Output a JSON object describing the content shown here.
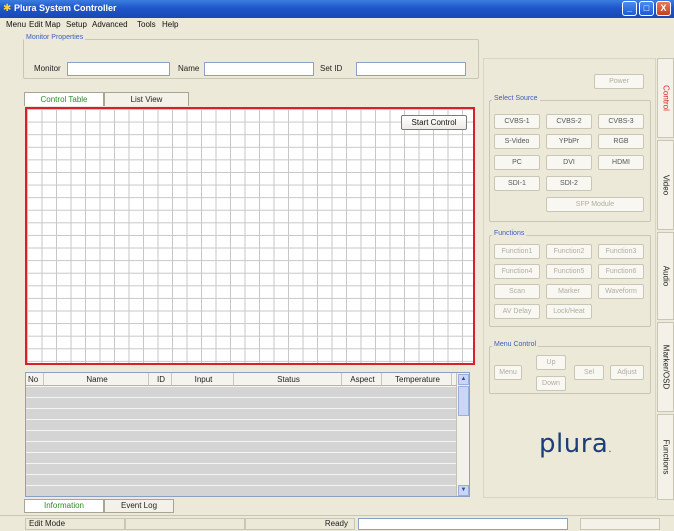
{
  "window": {
    "title": "Plura System Controller",
    "buttons": [
      "_",
      "□",
      "X"
    ]
  },
  "menu": [
    "Menu",
    "Edit Map",
    "Setup",
    "Advanced",
    "Tools",
    "Help"
  ],
  "monitor_properties": {
    "label": "Monitor Properties",
    "monitor_label": "Monitor",
    "monitor_value": "",
    "name_label": "Name",
    "name_value": "",
    "setid_label": "Set ID",
    "setid_value": ""
  },
  "view_tabs": [
    "Control Table",
    "List View"
  ],
  "start_control": "Start Control",
  "info_table": {
    "columns": [
      "No",
      "Name",
      "ID",
      "Input",
      "Status",
      "Aspect",
      "Temperature"
    ]
  },
  "bottom_tabs": [
    "Information",
    "Event Log"
  ],
  "right_panel": {
    "power": "Power",
    "select_source_label": "Select Source",
    "sources": [
      "CVBS-1",
      "CVBS-2",
      "CVBS-3",
      "S-Video",
      "YPbPr",
      "RGB",
      "PC",
      "DVI",
      "HDMI",
      "SDI-1",
      "SDI-2"
    ],
    "sfp_module": "SFP Module",
    "functions_label": "Functions",
    "functions": [
      "Function1",
      "Function2",
      "Function3",
      "Function4",
      "Function5",
      "Function6",
      "Scan",
      "Marker",
      "Waveform",
      "AV Delay",
      "Lock/Heat"
    ],
    "menu_control_label": "Menu Control",
    "menu_buttons": {
      "menu": "Menu",
      "up": "Up",
      "sel": "Sel",
      "down": "Down",
      "adjust": "Adjust"
    },
    "logo": "plura"
  },
  "side_tabs": [
    "Control",
    "Video",
    "Audio",
    "Marker/OSD",
    "Functions"
  ],
  "status_bar": {
    "mode": "Edit Mode",
    "state": "Ready"
  },
  "colors": {
    "highlight": "#d8202a",
    "active_tab": "#2f8a2a",
    "title_bar": "#1e56c9"
  }
}
